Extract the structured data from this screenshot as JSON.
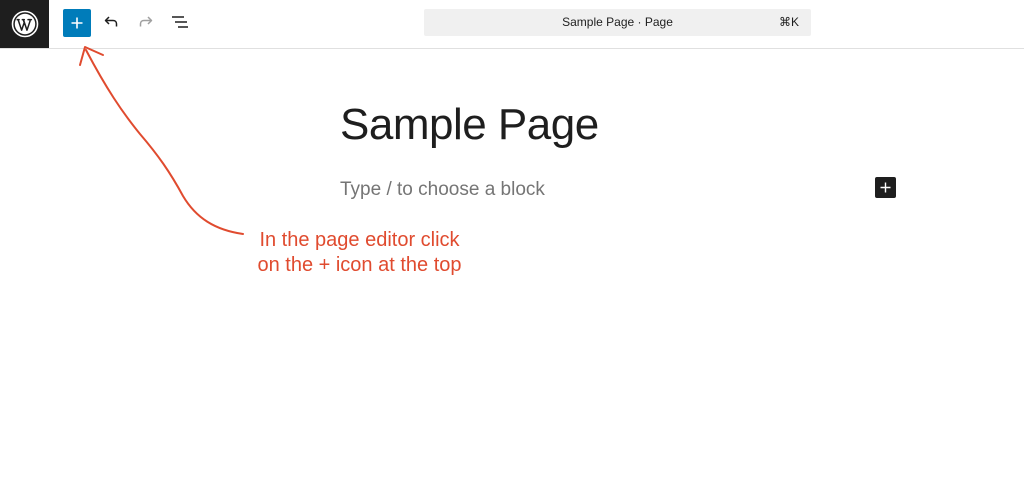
{
  "header": {
    "logo_icon": "wordpress-logo-icon",
    "inserter_icon": "plus-icon",
    "undo_icon": "undo-icon",
    "redo_icon": "redo-icon",
    "list_view_icon": "list-view-icon",
    "command_bar": {
      "title": "Sample Page · Page",
      "shortcut": "⌘K"
    }
  },
  "editor": {
    "post_title": "Sample Page",
    "block_placeholder": "Type / to choose a block",
    "block_inserter_icon": "plus-icon"
  },
  "annotation": {
    "line1": "In the page editor click",
    "line2": "on the + icon at the top",
    "color": "#e04b2f"
  },
  "colors": {
    "accent": "#007cba",
    "dark": "#1e1e1e",
    "placeholder": "#757575"
  }
}
